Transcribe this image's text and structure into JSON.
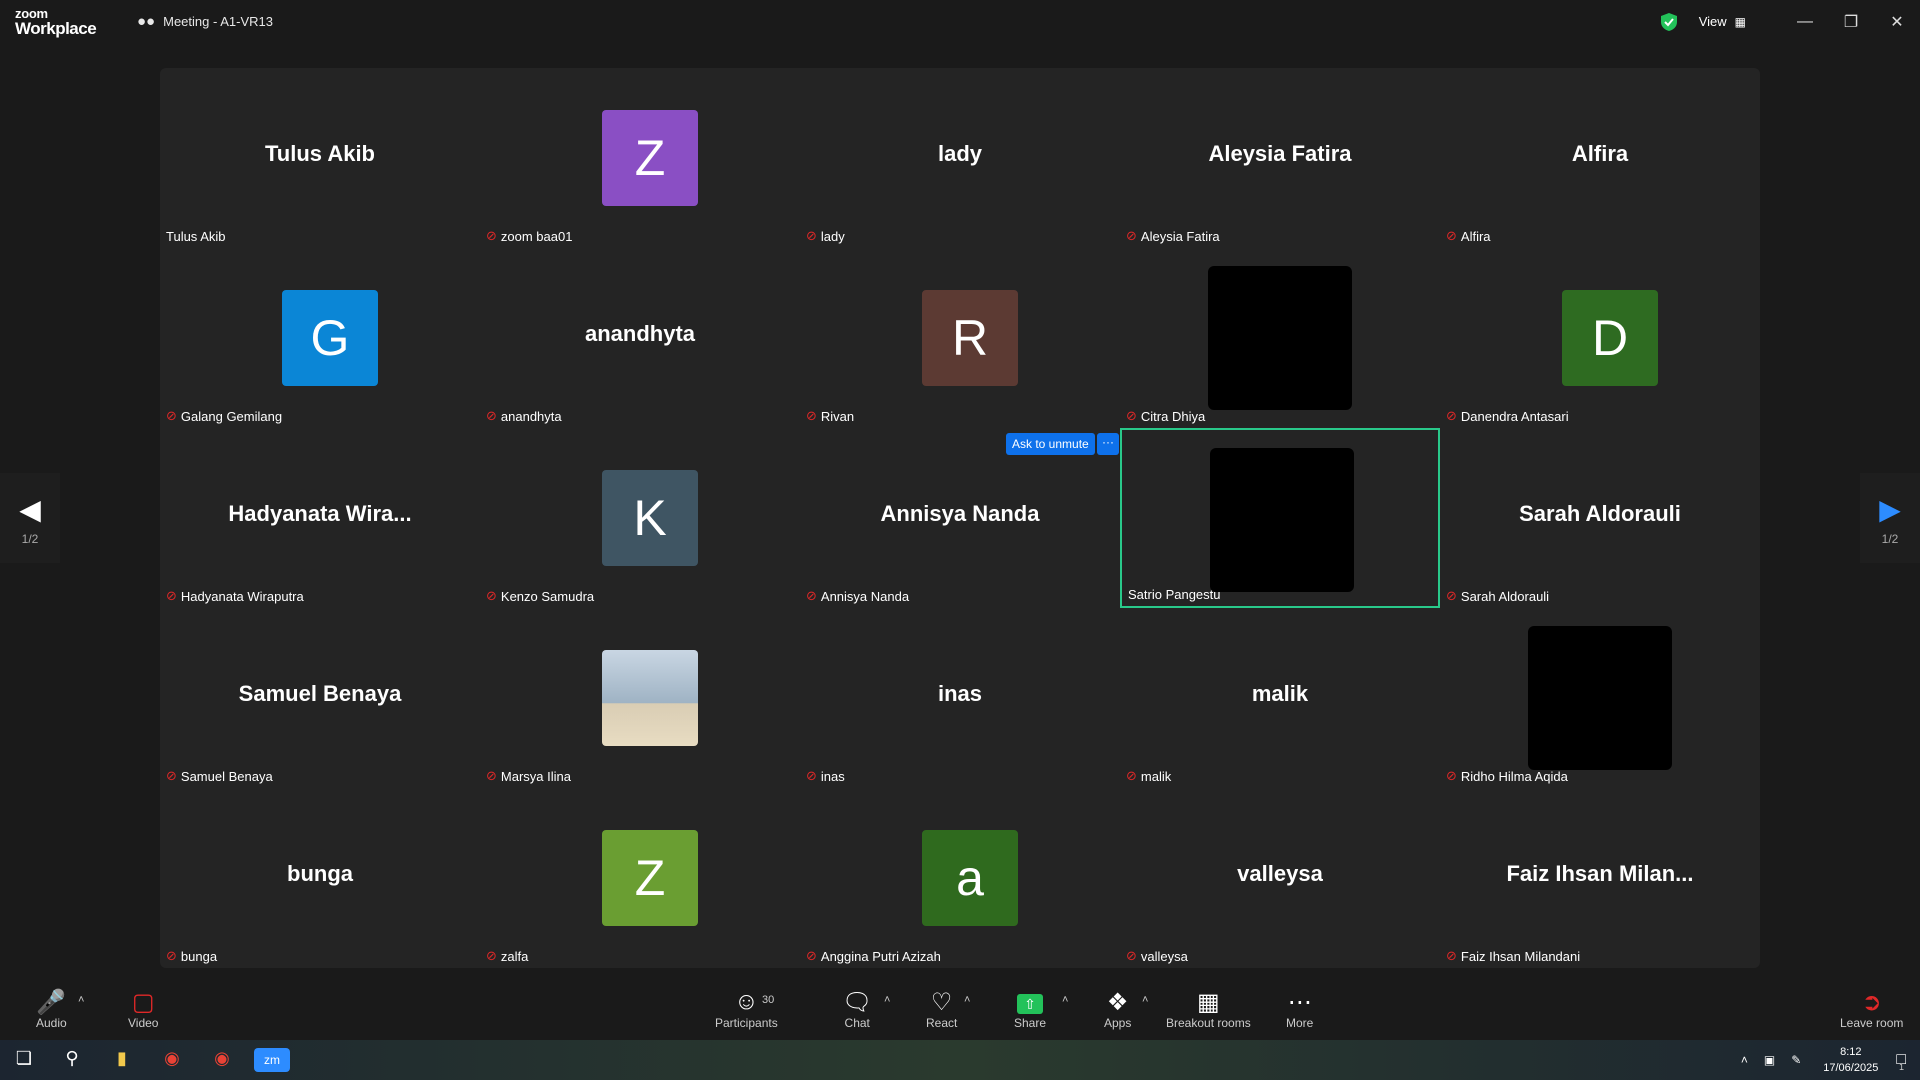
{
  "titlebar": {
    "logo_line1": "zoom",
    "logo_line2": "Workplace",
    "meeting_title": "Meeting - A1-VR13",
    "view_label": "View"
  },
  "pagination": {
    "left": "1/2",
    "right": "1/2"
  },
  "unmute_popup": {
    "ask_label": "Ask to unmute",
    "more_label": "···"
  },
  "tiles": [
    {
      "big": "Tulus Akib",
      "name": "Tulus Akib"
    },
    {
      "avatar": "Z",
      "color": "#8a4fc4",
      "name": "zoom baa01"
    },
    {
      "big": "lady",
      "name": "lady"
    },
    {
      "big": "Aleysia Fatira",
      "name": "Aleysia Fatira"
    },
    {
      "big": "Alfira",
      "name": "Alfira"
    },
    {
      "avatar": "G",
      "color": "#0b86d6",
      "name": "Galang Gemilang"
    },
    {
      "big": "anandhyta",
      "name": "anandhyta"
    },
    {
      "avatar": "R",
      "color": "#5c3a33",
      "name": "Rivan"
    },
    {
      "video": true,
      "name": "Citra Dhiya"
    },
    {
      "avatar": "D",
      "color": "#2e6b21",
      "name": "Danendra Antasari"
    },
    {
      "big": "Hadyanata  Wira...",
      "name": "Hadyanata Wiraputra"
    },
    {
      "avatar": "K",
      "color": "#3f5563",
      "name": "Kenzo Samudra"
    },
    {
      "big": "Annisya Nanda",
      "name": "Annisya Nanda"
    },
    {
      "video": true,
      "name": "Satrio Pangestu",
      "active": true
    },
    {
      "big": "Sarah Aldorauli",
      "name": "Sarah Aldorauli"
    },
    {
      "big": "Samuel Benaya",
      "name": "Samuel Benaya"
    },
    {
      "photo": true,
      "name": "Marsya Ilina"
    },
    {
      "big": "inas",
      "name": "inas"
    },
    {
      "big": "malik",
      "name": "malik"
    },
    {
      "video": true,
      "name": "Ridho Hilma Aqida"
    },
    {
      "big": "bunga",
      "name": "bunga"
    },
    {
      "avatar": "Z",
      "color": "#6a9e32",
      "name": "zalfa"
    },
    {
      "avatar": "a",
      "color": "#2f6a1e",
      "name": "Anggina Putri Azizah"
    },
    {
      "big": "valleysa",
      "name": "valleysa"
    },
    {
      "big": "Faiz  Ihsan  Milan...",
      "name": "Faiz Ihsan Milandani"
    }
  ],
  "toolbar": {
    "audio": "Audio",
    "video": "Video",
    "participants": "Participants",
    "participants_count": "30",
    "chat": "Chat",
    "react": "React",
    "share": "Share",
    "apps": "Apps",
    "breakout": "Breakout rooms",
    "more": "More",
    "leave": "Leave room"
  },
  "taskbar": {
    "time": "8:12",
    "date": "17/06/2025",
    "notif_count": "1"
  }
}
